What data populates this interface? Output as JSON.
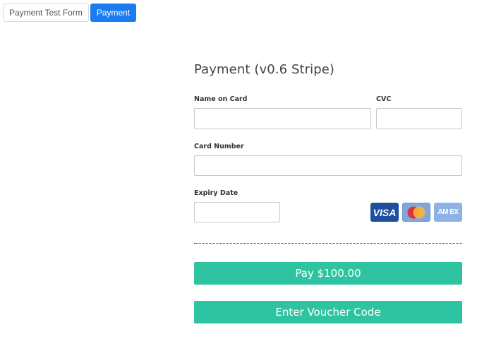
{
  "tabs": [
    {
      "label": "Payment Test Form",
      "active": false
    },
    {
      "label": "Payment",
      "active": true
    }
  ],
  "form": {
    "title": "Payment (v0.6 Stripe)",
    "name_on_card": {
      "label": "Name on Card",
      "value": "",
      "placeholder": ""
    },
    "cvc": {
      "label": "CVC",
      "value": "",
      "placeholder": ""
    },
    "card_number": {
      "label": "Card Number",
      "value": "",
      "placeholder": ""
    },
    "expiry_date": {
      "label": "Expiry Date",
      "value": "",
      "placeholder": ""
    },
    "card_logos": [
      {
        "icon": "visa-icon",
        "text": "VISA"
      },
      {
        "icon": "mastercard-icon",
        "text": ""
      },
      {
        "icon": "amex-icon",
        "text": "AM EX"
      }
    ],
    "pay_button": "Pay $100.00",
    "voucher_button": "Enter Voucher Code"
  },
  "colors": {
    "accent_blue": "#1a7cf0",
    "button_teal": "#2ec4a1",
    "visa_blue": "#1d4f9f"
  }
}
